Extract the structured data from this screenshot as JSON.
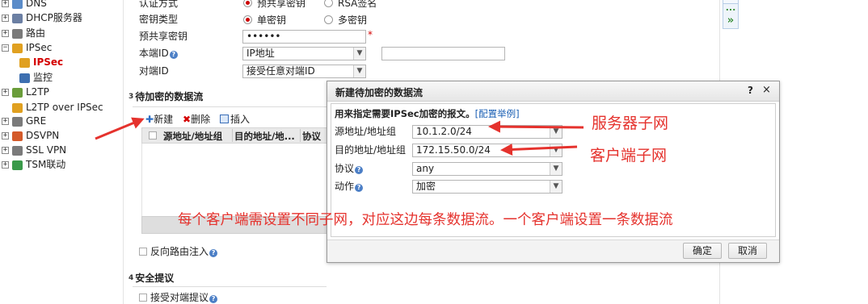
{
  "nav": {
    "items": [
      {
        "label": "DNS",
        "exp": "+",
        "icon": "dns-icon",
        "color": "#5b8cc9"
      },
      {
        "label": "DHCP服务器",
        "exp": "+",
        "icon": "dhcp-server-icon",
        "color": "#6b7fa3"
      },
      {
        "label": "路由",
        "exp": "+",
        "icon": "route-icon",
        "color": "#7a7a7a"
      },
      {
        "label": "IPSec",
        "exp": "−",
        "icon": "ipsec-icon",
        "color": "#e0a020"
      },
      {
        "label": "IPSec",
        "exp": "",
        "icon": "ipsec-policy-icon",
        "color": "#e0a020",
        "selected": true
      },
      {
        "label": "监控",
        "exp": "",
        "icon": "monitor-icon",
        "color": "#3d6fb0"
      },
      {
        "label": "L2TP",
        "exp": "+",
        "icon": "l2tp-icon",
        "color": "#6a9d3a"
      },
      {
        "label": "L2TP over IPSec",
        "exp": "",
        "icon": "l2tp-over-ipsec-icon",
        "color": "#e0a020"
      },
      {
        "label": "GRE",
        "exp": "+",
        "icon": "gre-icon",
        "color": "#7a7a7a"
      },
      {
        "label": "DSVPN",
        "exp": "+",
        "icon": "dsvpn-icon",
        "color": "#d45a2a"
      },
      {
        "label": "SSL VPN",
        "exp": "+",
        "icon": "ssl-vpn-icon",
        "color": "#7a7a7a"
      },
      {
        "label": "TSM联动",
        "exp": "+",
        "icon": "tsm-shield-icon",
        "color": "#3a9a4a"
      }
    ]
  },
  "form": {
    "auth_method_label": "认证方式",
    "auth_option_psk": "预共享密钥",
    "auth_option_rsa": "RSA签名",
    "key_type_label": "密钥类型",
    "key_option_single": "单密钥",
    "key_option_multi": "多密钥",
    "psk_label": "预共享密钥",
    "psk_value": "••••••",
    "required_mark": "*",
    "local_id_label": "本端ID",
    "local_id_value": "IP地址",
    "peer_id_label": "对端ID",
    "peer_id_value": "接受任意对端ID"
  },
  "section3": {
    "num": "3",
    "title": "待加密的数据流",
    "toolbar": {
      "new": "新建",
      "delete": "删除",
      "insert": "插入"
    },
    "columns": [
      "源地址/地址组",
      "目的地址/地...",
      "协议"
    ],
    "reverse_route_label": "反向路由注入"
  },
  "section4": {
    "num": "4",
    "title": "安全提议",
    "accept_peer_label": "接受对端提议"
  },
  "side_buttons": {
    "more": "...",
    "expand": "»"
  },
  "dialog": {
    "title": "新建待加密的数据流",
    "help": "?",
    "close": "×",
    "desc": "用来指定需要IPSec加密的报文。",
    "desc_link": "配置举例",
    "fields": [
      {
        "label": "源地址/地址组",
        "value": "10.1.2.0/24",
        "help": false
      },
      {
        "label": "目的地址/地址组",
        "value": "172.15.50.0/24",
        "help": false
      },
      {
        "label": "协议",
        "value": "any",
        "help": true
      },
      {
        "label": "动作",
        "value": "加密",
        "help": true
      }
    ],
    "ok": "确定",
    "cancel": "取消"
  },
  "annotations": {
    "server_subnet": "服务器子网",
    "client_subnet": "客户端子网",
    "note": "每个客户端需设置不同子网，对应这边每条数据流。一个客户端设置一条数据流"
  },
  "colors": {
    "annotation_red": "#e5322d",
    "link_blue": "#1a5fb4",
    "required_red": "#d40000"
  }
}
